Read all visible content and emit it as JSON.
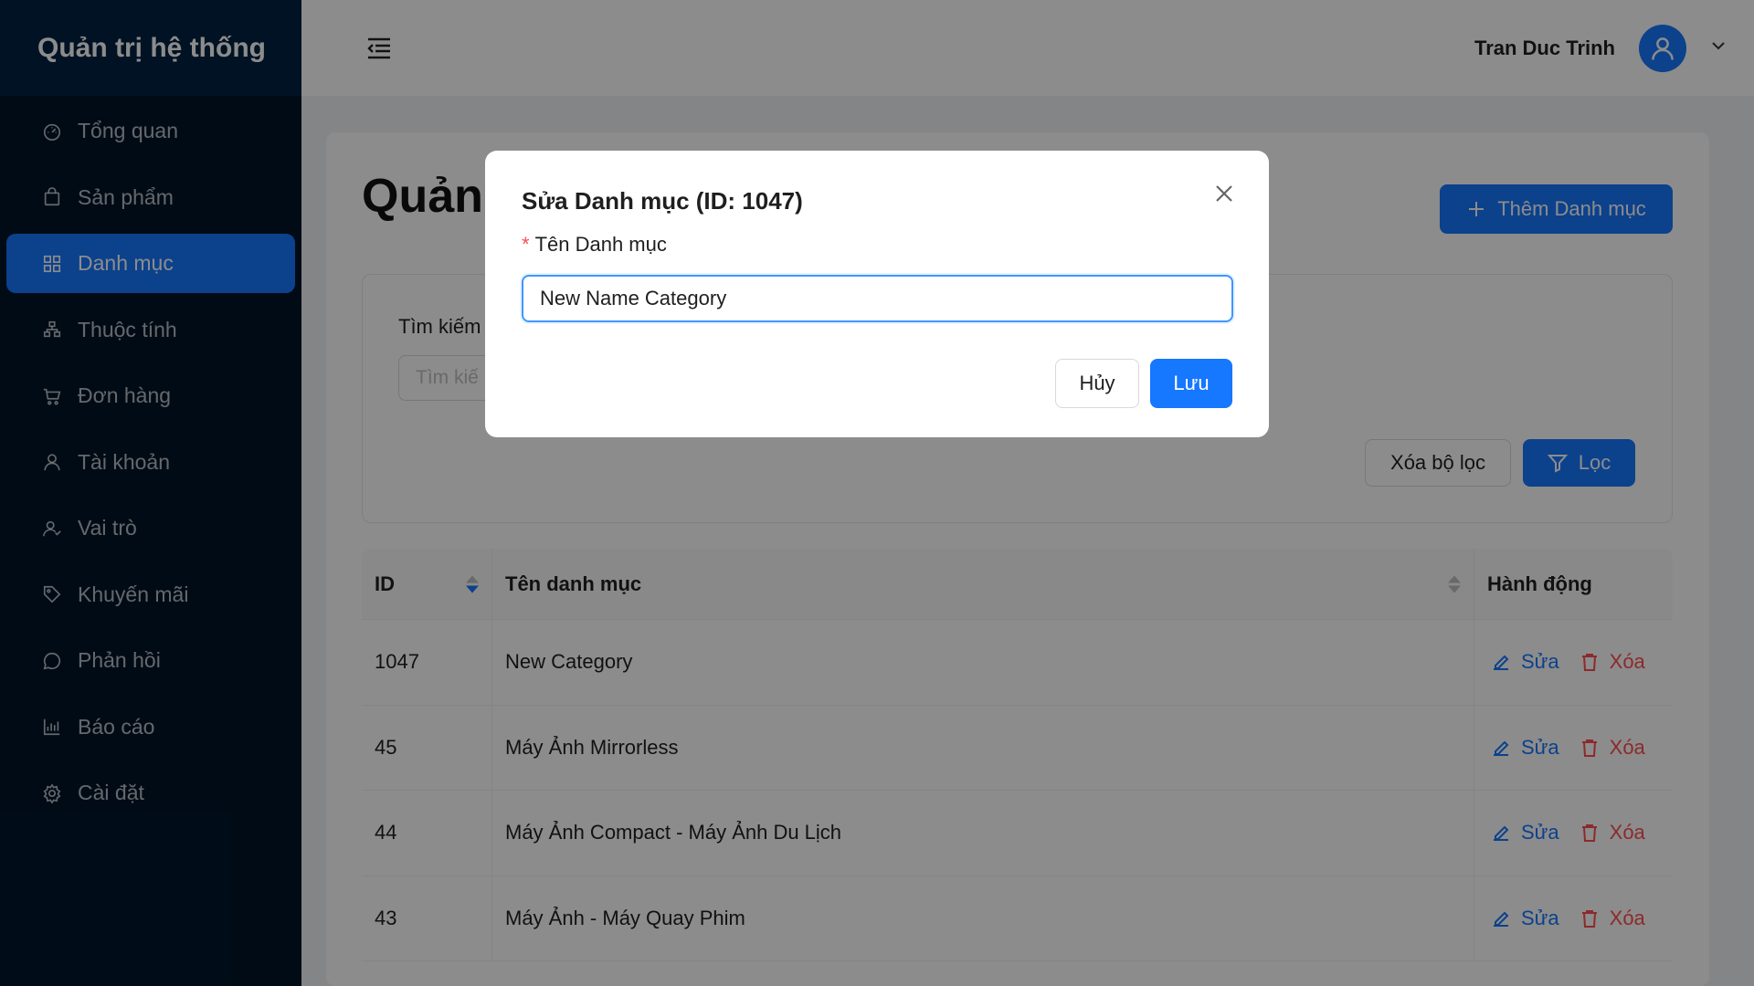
{
  "sidebar": {
    "brand": "Quản trị hệ thống",
    "items": [
      {
        "label": "Tổng quan",
        "icon": "dashboard-icon"
      },
      {
        "label": "Sản phẩm",
        "icon": "shopping-bag-icon"
      },
      {
        "label": "Danh mục",
        "icon": "appstore-icon",
        "active": true
      },
      {
        "label": "Thuộc tính",
        "icon": "cluster-icon"
      },
      {
        "label": "Đơn hàng",
        "icon": "shopping-cart-icon"
      },
      {
        "label": "Tài khoản",
        "icon": "user-icon"
      },
      {
        "label": "Vai trò",
        "icon": "team-icon"
      },
      {
        "label": "Khuyến mãi",
        "icon": "tag-icon"
      },
      {
        "label": "Phản hồi",
        "icon": "message-icon"
      },
      {
        "label": "Báo cáo",
        "icon": "bar-chart-icon"
      },
      {
        "label": "Cài đặt",
        "icon": "setting-icon"
      }
    ]
  },
  "header": {
    "user_name": "Tran Duc Trinh"
  },
  "main": {
    "title": "Quản",
    "add_button": "Thêm Danh mục",
    "filter": {
      "search_label": "Tìm kiếm",
      "search_placeholder": "Tìm kiế",
      "clear_button": "Xóa bộ lọc",
      "filter_button": "Lọc"
    },
    "table": {
      "headers": {
        "id": "ID",
        "name": "Tên danh mục",
        "actions": "Hành động"
      },
      "rows": [
        {
          "id": "1047",
          "name": "New Category"
        },
        {
          "id": "45",
          "name": "Máy Ảnh Mirrorless"
        },
        {
          "id": "44",
          "name": "Máy Ảnh Compact - Máy Ảnh Du Lịch"
        },
        {
          "id": "43",
          "name": "Máy Ảnh - Máy Quay Phim"
        }
      ],
      "edit_label": "Sửa",
      "delete_label": "Xóa"
    }
  },
  "modal": {
    "title": "Sửa Danh mục (ID: 1047)",
    "field_label": "Tên Danh mục",
    "required_mark": "*",
    "field_value": "New Name Category",
    "cancel_button": "Hủy",
    "save_button": "Lưu"
  },
  "colors": {
    "primary": "#1677ff",
    "sidebar_bg": "#001529",
    "danger": "#ff4d4f"
  }
}
